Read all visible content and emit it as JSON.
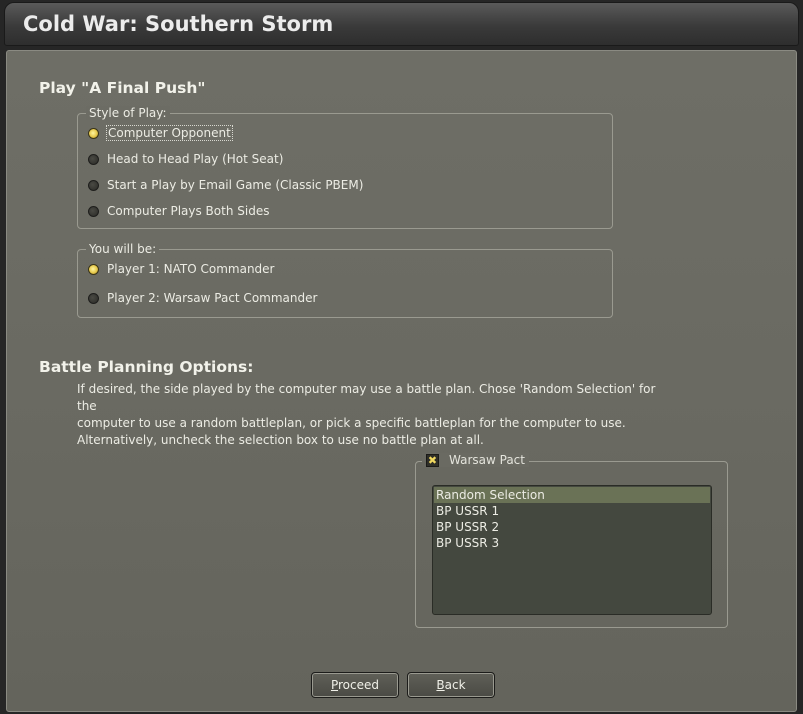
{
  "window": {
    "title": "Cold War: Southern Storm"
  },
  "play_section": {
    "heading": "Play \"A Final Push\""
  },
  "style_of_play": {
    "legend": "Style of Play:",
    "options": [
      {
        "label": "Computer Opponent",
        "selected": true
      },
      {
        "label": "Head to Head Play (Hot Seat)",
        "selected": false
      },
      {
        "label": "Start a Play by Email Game (Classic PBEM)",
        "selected": false
      },
      {
        "label": "Computer Plays Both Sides",
        "selected": false
      }
    ]
  },
  "you_will_be": {
    "legend": "You will be:",
    "options": [
      {
        "label": "Player 1: NATO Commander",
        "selected": true
      },
      {
        "label": "Player 2: Warsaw Pact Commander",
        "selected": false
      }
    ]
  },
  "battle_planning": {
    "heading": "Battle Planning Options:",
    "description": [
      "If desired, the side played by the computer may use a battle plan.  Chose 'Random Selection' for the",
      "computer to use a random battleplan, or pick a specific battleplan for the computer to use.",
      "Alternatively, uncheck the selection box to use no battle plan at all."
    ],
    "side": {
      "label": "Warsaw Pact",
      "checked": true
    },
    "plans": [
      {
        "label": "Random Selection",
        "selected": true
      },
      {
        "label": "BP USSR 1",
        "selected": false
      },
      {
        "label": "BP USSR 2",
        "selected": false
      },
      {
        "label": "BP USSR 3",
        "selected": false
      }
    ]
  },
  "buttons": {
    "proceed": {
      "accel": "P",
      "rest": "roceed"
    },
    "back": {
      "accel": "B",
      "rest": "ack"
    }
  },
  "colors": {
    "accent_selected": "#e6c84a",
    "list_selected": "#6a7256"
  }
}
